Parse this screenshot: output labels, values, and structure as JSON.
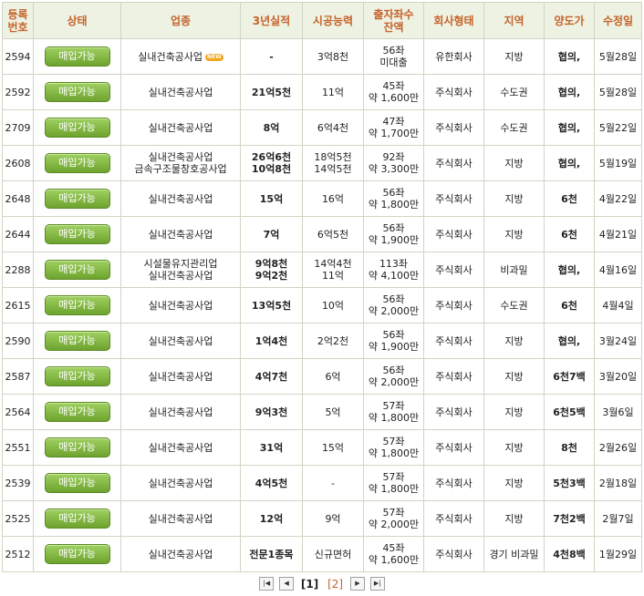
{
  "headers": [
    "등록\n번호",
    "상태",
    "업종",
    "3년실적",
    "시공능력",
    "출자좌수\n잔액",
    "회사형태",
    "지역",
    "양도가",
    "수정일"
  ],
  "status_label": "매입가능",
  "new_badge": "NEW",
  "rows": [
    {
      "id": "2594",
      "ind": [
        "실내건축공사업"
      ],
      "isNew": true,
      "perf": [
        "-"
      ],
      "cap": [
        "3억8천"
      ],
      "bal": [
        "56좌",
        "미대출"
      ],
      "type": "유한회사",
      "region": "지방",
      "price": "협의,",
      "date": "5월28일"
    },
    {
      "id": "2592",
      "ind": [
        "실내건축공사업"
      ],
      "perf": [
        "21억5천"
      ],
      "cap": [
        "11억"
      ],
      "bal": [
        "45좌",
        "약 1,600만"
      ],
      "type": "주식회사",
      "region": "수도권",
      "price": "협의,",
      "date": "5월28일"
    },
    {
      "id": "2709",
      "ind": [
        "실내건축공사업"
      ],
      "perf": [
        "8억"
      ],
      "cap": [
        "6억4천"
      ],
      "bal": [
        "47좌",
        "약 1,700만"
      ],
      "type": "주식회사",
      "region": "수도권",
      "price": "협의,",
      "date": "5월22일"
    },
    {
      "id": "2608",
      "ind": [
        "실내건축공사업",
        "금속구조물창호공사업"
      ],
      "perf": [
        "26억6천",
        "10억8천"
      ],
      "cap": [
        "18억5천",
        "14억5천"
      ],
      "bal": [
        "92좌",
        "약 3,300만"
      ],
      "type": "주식회사",
      "region": "지방",
      "price": "협의,",
      "date": "5월19일"
    },
    {
      "id": "2648",
      "ind": [
        "실내건축공사업"
      ],
      "perf": [
        "15억"
      ],
      "cap": [
        "16억"
      ],
      "bal": [
        "56좌",
        "약 1,800만"
      ],
      "type": "주식회사",
      "region": "지방",
      "price": "6천",
      "date": "4월22일"
    },
    {
      "id": "2644",
      "ind": [
        "실내건축공사업"
      ],
      "perf": [
        "7억"
      ],
      "cap": [
        "6억5천"
      ],
      "bal": [
        "56좌",
        "약 1,900만"
      ],
      "type": "주식회사",
      "region": "지방",
      "price": "6천",
      "date": "4월21일"
    },
    {
      "id": "2288",
      "ind": [
        "시설물유지관리업",
        "실내건축공사업"
      ],
      "perf": [
        "9억8천",
        "9억2천"
      ],
      "cap": [
        "14억4천",
        "11억"
      ],
      "bal": [
        "113좌",
        "약 4,100만"
      ],
      "type": "주식회사",
      "region": "비과밀",
      "price": "협의,",
      "date": "4월16일"
    },
    {
      "id": "2615",
      "ind": [
        "실내건축공사업"
      ],
      "perf": [
        "13억5천"
      ],
      "cap": [
        "10억"
      ],
      "bal": [
        "56좌",
        "약 2,000만"
      ],
      "type": "주식회사",
      "region": "수도권",
      "price": "6천",
      "date": "4월4일"
    },
    {
      "id": "2590",
      "ind": [
        "실내건축공사업"
      ],
      "perf": [
        "1억4천"
      ],
      "cap": [
        "2억2천"
      ],
      "bal": [
        "56좌",
        "약 1,900만"
      ],
      "type": "주식회사",
      "region": "지방",
      "price": "협의,",
      "date": "3월24일"
    },
    {
      "id": "2587",
      "ind": [
        "실내건축공사업"
      ],
      "perf": [
        "4억7천"
      ],
      "cap": [
        "6억"
      ],
      "bal": [
        "56좌",
        "약 2,000만"
      ],
      "type": "주식회사",
      "region": "지방",
      "price": "6천7백",
      "date": "3월20일"
    },
    {
      "id": "2564",
      "ind": [
        "실내건축공사업"
      ],
      "perf": [
        "9억3천"
      ],
      "cap": [
        "5억"
      ],
      "bal": [
        "57좌",
        "약 1,800만"
      ],
      "type": "주식회사",
      "region": "지방",
      "price": "6천5백",
      "date": "3월6일"
    },
    {
      "id": "2551",
      "ind": [
        "실내건축공사업"
      ],
      "perf": [
        "31억"
      ],
      "cap": [
        "15억"
      ],
      "bal": [
        "57좌",
        "약 1,800만"
      ],
      "type": "주식회사",
      "region": "지방",
      "price": "8천",
      "date": "2월26일"
    },
    {
      "id": "2539",
      "ind": [
        "실내건축공사업"
      ],
      "perf": [
        "4억5천"
      ],
      "cap": [
        "-"
      ],
      "bal": [
        "57좌",
        "약 1,800만"
      ],
      "type": "주식회사",
      "region": "지방",
      "price": "5천3백",
      "date": "2월18일"
    },
    {
      "id": "2525",
      "ind": [
        "실내건축공사업"
      ],
      "perf": [
        "12억"
      ],
      "cap": [
        "9억"
      ],
      "bal": [
        "57좌",
        "약 2,000만"
      ],
      "type": "주식회사",
      "region": "지방",
      "price": "7천2백",
      "date": "2월7일"
    },
    {
      "id": "2512",
      "ind": [
        "실내건축공사업"
      ],
      "perf": [
        "전문1종목"
      ],
      "cap": [
        "신규면허"
      ],
      "bal": [
        "45좌",
        "약 1,600만"
      ],
      "type": "주식회사",
      "region": "경기 비과밀",
      "price": "4천8백",
      "date": "1월29일"
    }
  ],
  "pagination": {
    "first_icon": "first-page-icon",
    "prev_icon": "prev-page-icon",
    "next_icon": "next-page-icon",
    "last_icon": "last-page-icon",
    "current": "[1]",
    "other": "[2]"
  },
  "colors": {
    "header_text": "#c5632a",
    "header_bg": "#eef2e3",
    "button": "#7fb53b"
  }
}
